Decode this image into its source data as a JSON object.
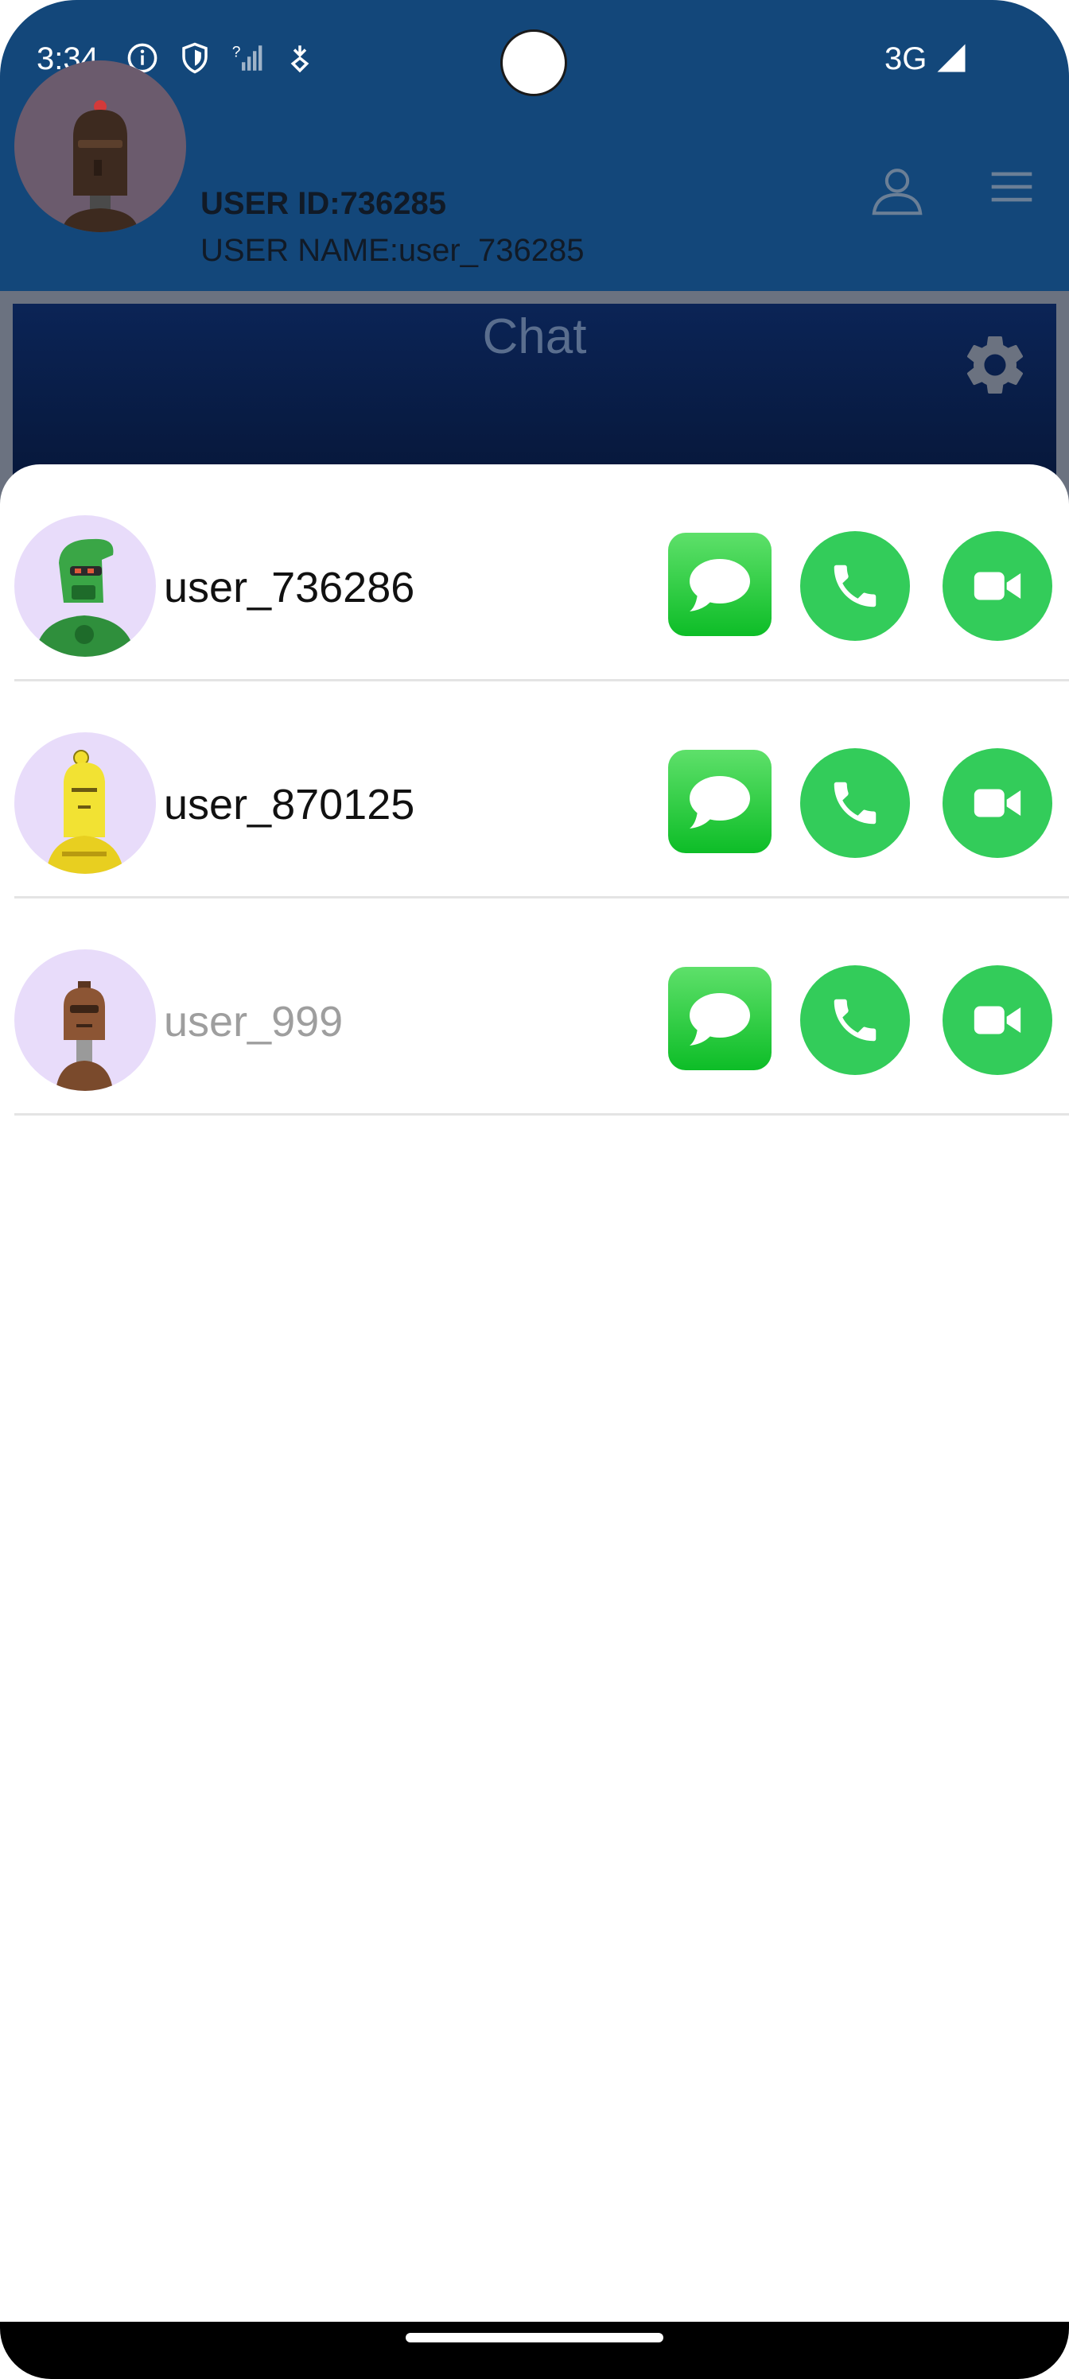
{
  "status_bar": {
    "time": "3:34",
    "network": "3G",
    "icons": [
      "info-icon",
      "shield-icon",
      "signal-unknown-icon",
      "download-icon",
      "cell-signal-icon"
    ]
  },
  "profile": {
    "user_id": "USER ID:736285",
    "user_name": "USER NAME:user_736285",
    "avatar": "robot-avatar-brown"
  },
  "header_actions": [
    "person-icon",
    "menu-icon"
  ],
  "chat_banner": {
    "title": "Chat",
    "icon": "gear-icon"
  },
  "contacts": [
    {
      "name": "user_736286",
      "avatar": "robot-avatar-green",
      "online": true
    },
    {
      "name": "user_870125",
      "avatar": "robot-avatar-yellow",
      "online": true
    },
    {
      "name": "user_999",
      "avatar": "robot-avatar-brown",
      "online": false
    }
  ],
  "row_actions": [
    "message-icon",
    "phone-icon",
    "video-camera-icon"
  ],
  "colors": {
    "header": "#13477a",
    "banner": "#0b2456",
    "action_green": "#33cc5a",
    "avatar_bg": "#e8dcfa"
  }
}
